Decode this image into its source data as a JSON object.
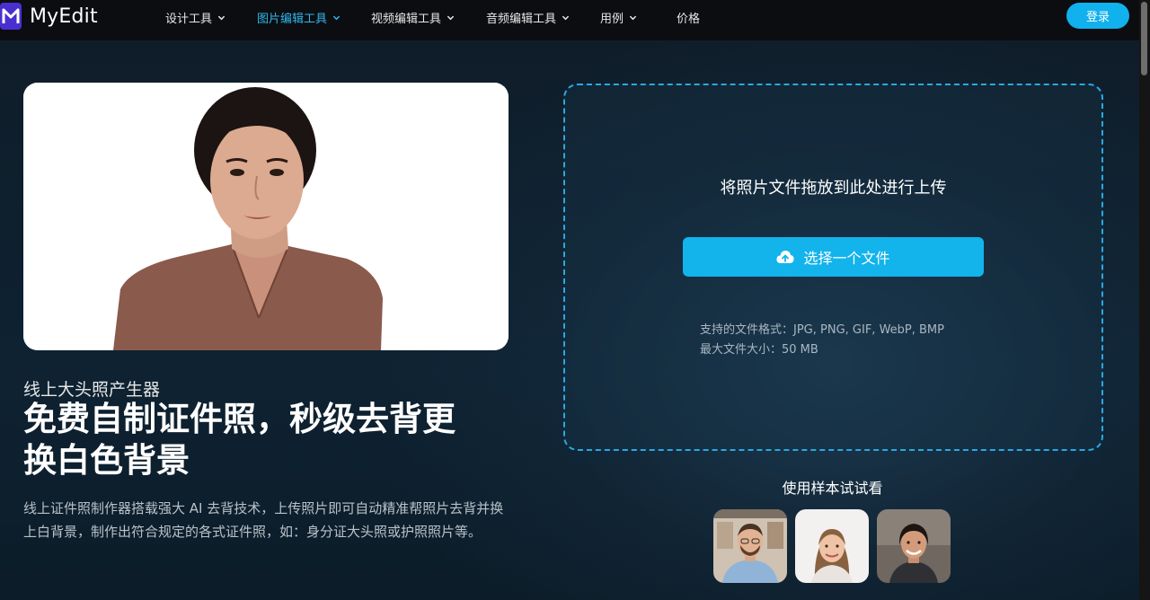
{
  "brand": {
    "name": "MyEdit",
    "logo_letter": "M"
  },
  "nav": [
    {
      "label": "设计工具",
      "has_dropdown": true,
      "active": false
    },
    {
      "label": "图片编辑工具",
      "has_dropdown": true,
      "active": true
    },
    {
      "label": "视频编辑工具",
      "has_dropdown": true,
      "active": false
    },
    {
      "label": "音频编辑工具",
      "has_dropdown": true,
      "active": false
    },
    {
      "label": "用例",
      "has_dropdown": true,
      "active": false
    },
    {
      "label": "价格",
      "has_dropdown": false,
      "active": false
    }
  ],
  "header": {
    "login_label": "登录"
  },
  "hero": {
    "subtitle": "线上大头照产生器",
    "headline_line1": "免费自制证件照，秒级去背更",
    "headline_line2": "换白色背景",
    "description": "线上证件照制作器搭载强大 AI 去背技术，上传照片即可自动精准帮照片去背并换上白背景，制作出符合规定的各式证件照，如：身分证大头照或护照照片等。"
  },
  "upload": {
    "title": "将照片文件拖放到此处进行上传",
    "button_label": "选择一个文件",
    "formats_line": "支持的文件格式：JPG, PNG, GIF, WebP, BMP",
    "size_line": "最大文件大小：50 MB"
  },
  "samples": {
    "title": "使用样本试试看"
  },
  "colors": {
    "accent": "#13b3ec",
    "active_nav": "#30b8ee",
    "header_bg": "#0b0d10",
    "page_bg": "#0d1a25"
  },
  "icons": [
    "chevron-down-icon",
    "cloud-upload-icon"
  ]
}
